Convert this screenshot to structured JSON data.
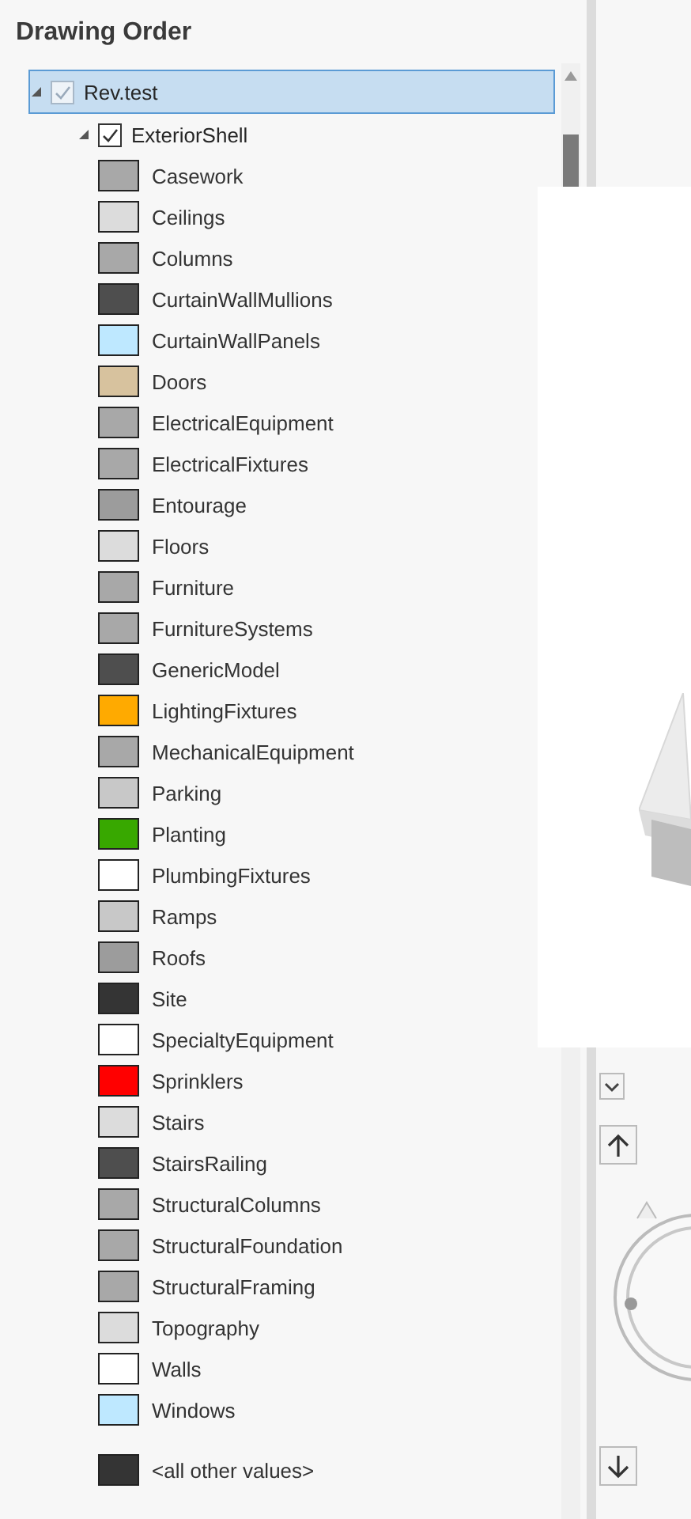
{
  "panel": {
    "title": "Drawing Order"
  },
  "tree": [
    {
      "label": "Rev.test",
      "checked": true,
      "disabled": true,
      "expanded": true,
      "selected": true,
      "children": [
        {
          "label": "ExteriorShell",
          "checked": true,
          "disabled": false,
          "expanded": true,
          "selected": false,
          "symbols": [
            {
              "label": "Casework",
              "color": "#a8a8a8"
            },
            {
              "label": "Ceilings",
              "color": "#dcdcdc"
            },
            {
              "label": "Columns",
              "color": "#a8a8a8"
            },
            {
              "label": "CurtainWallMullions",
              "color": "#4e4e4e"
            },
            {
              "label": "CurtainWallPanels",
              "color": "#bee8ff"
            },
            {
              "label": "Doors",
              "color": "#d7c29e"
            },
            {
              "label": "ElectricalEquipment",
              "color": "#a8a8a8"
            },
            {
              "label": "ElectricalFixtures",
              "color": "#a8a8a8"
            },
            {
              "label": "Entourage",
              "color": "#9c9c9c"
            },
            {
              "label": "Floors",
              "color": "#dcdcdc"
            },
            {
              "label": "Furniture",
              "color": "#a8a8a8"
            },
            {
              "label": "FurnitureSystems",
              "color": "#a8a8a8"
            },
            {
              "label": "GenericModel",
              "color": "#4e4e4e"
            },
            {
              "label": "LightingFixtures",
              "color": "#ffaa00"
            },
            {
              "label": "MechanicalEquipment",
              "color": "#a8a8a8"
            },
            {
              "label": "Parking",
              "color": "#c8c8c8"
            },
            {
              "label": "Planting",
              "color": "#38a800"
            },
            {
              "label": "PlumbingFixtures",
              "color": "#ffffff"
            },
            {
              "label": "Ramps",
              "color": "#c8c8c8"
            },
            {
              "label": "Roofs",
              "color": "#9c9c9c"
            },
            {
              "label": "Site",
              "color": "#343434"
            },
            {
              "label": "SpecialtyEquipment",
              "color": "#ffffff"
            },
            {
              "label": "Sprinklers",
              "color": "#ff0000"
            },
            {
              "label": "Stairs",
              "color": "#dcdcdc"
            },
            {
              "label": "StairsRailing",
              "color": "#4e4e4e"
            },
            {
              "label": "StructuralColumns",
              "color": "#a8a8a8"
            },
            {
              "label": "StructuralFoundation",
              "color": "#a8a8a8"
            },
            {
              "label": "StructuralFraming",
              "color": "#a8a8a8"
            },
            {
              "label": "Topography",
              "color": "#dcdcdc"
            },
            {
              "label": "Walls",
              "color": "#ffffff"
            },
            {
              "label": "Windows",
              "color": "#bee8ff"
            }
          ],
          "other_values": {
            "label": "<all other values>",
            "color": "#343434"
          }
        }
      ]
    }
  ]
}
